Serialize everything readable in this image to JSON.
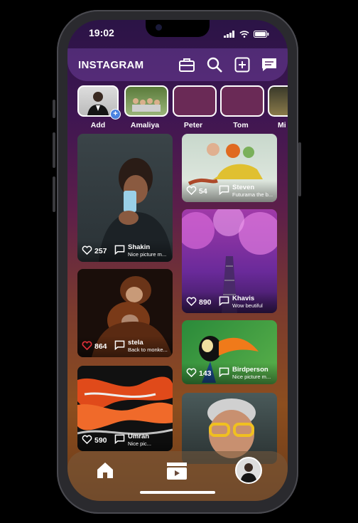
{
  "status_bar": {
    "time": "19:02"
  },
  "header": {
    "brand": "INSTAGRAM"
  },
  "header_icons": [
    "briefcase-icon",
    "search-icon",
    "add-post-icon",
    "messages-icon"
  ],
  "stories": [
    {
      "name": "Add"
    },
    {
      "name": "Amaliya"
    },
    {
      "name": "Peter"
    },
    {
      "name": "Tom"
    },
    {
      "name": "Mi"
    }
  ],
  "posts": [
    {
      "user": "Shakin",
      "caption": "Nice picture m...",
      "likes": "257",
      "liked": false
    },
    {
      "user": "Steven",
      "caption": "Futurama the b...",
      "likes": "54",
      "liked": false
    },
    {
      "user": "stela",
      "caption": "Back to monke...",
      "likes": "864",
      "liked": true
    },
    {
      "user": "Khavis",
      "caption": "Wow beutiful",
      "likes": "890",
      "liked": false
    },
    {
      "user": "Umran",
      "caption": "Nice pic...",
      "likes": "590",
      "liked": false
    },
    {
      "user": "Birdperson",
      "caption": "Nice picture m...",
      "likes": "143",
      "liked": false
    }
  ],
  "nav": [
    "home-icon",
    "reels-icon",
    "profile-avatar"
  ],
  "colors": {
    "liked": "#e0303a",
    "accent": "#4a82e0"
  }
}
